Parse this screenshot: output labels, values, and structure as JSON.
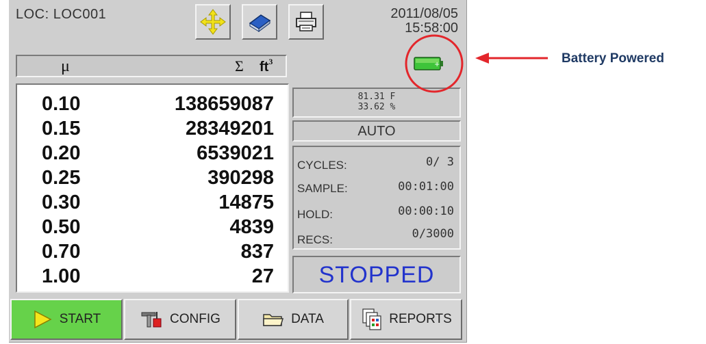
{
  "header": {
    "location": "LOC:  LOC001",
    "date": "2011/08/05",
    "time": "15:58:00"
  },
  "toolbar": {
    "icons": [
      "move-arrows-icon",
      "book-icon",
      "printer-icon"
    ]
  },
  "table": {
    "col_size": "μ",
    "col_sum": "Σ",
    "col_unit": "ft",
    "col_unit_exp": "3",
    "rows": [
      {
        "size": "0.10",
        "count": "138659087"
      },
      {
        "size": "0.15",
        "count": "28349201"
      },
      {
        "size": "0.20",
        "count": "6539021"
      },
      {
        "size": "0.25",
        "count": "390298"
      },
      {
        "size": "0.30",
        "count": "14875"
      },
      {
        "size": "0.50",
        "count": "4839"
      },
      {
        "size": "0.70",
        "count": "837"
      },
      {
        "size": "1.00",
        "count": "27"
      }
    ]
  },
  "env": {
    "temperature": "81.31 F",
    "humidity": "33.62 %"
  },
  "mode": "AUTO",
  "stats": {
    "cycles_label": "CYCLES:",
    "cycles_value": "0/  3",
    "sample_label": "SAMPLE:",
    "sample_value": "00:01:00",
    "hold_label": "HOLD:",
    "hold_value": "00:00:10",
    "recs_label": "RECS:",
    "recs_value": "0/3000"
  },
  "status": "STOPPED",
  "buttons": {
    "start": "START",
    "config": "CONFIG",
    "data": "DATA",
    "reports": "REPORTS"
  },
  "annotation": {
    "label": "Battery Powered"
  },
  "colors": {
    "status_text": "#2233cc",
    "start_button": "#66d24a",
    "battery": "#3ec43a",
    "annotation_red": "#e3262b",
    "annotation_text": "#1f3a64"
  }
}
